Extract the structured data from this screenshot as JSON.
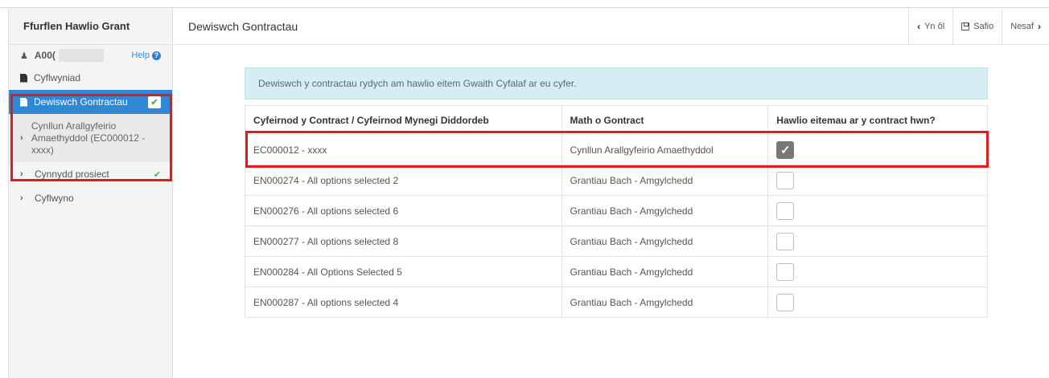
{
  "sidebar": {
    "title": "Ffurflen Hawlio Grant",
    "user_id": "A00(",
    "help_label": "Help",
    "items": [
      {
        "label": "Cyflwyniad"
      },
      {
        "label": "Dewiswch Gontractau",
        "checked": "✔"
      },
      {
        "label": "Cynllun Arallgyfeirio Amaethyddol (EC000012 - xxxx)",
        "chevron": "›"
      },
      {
        "label": "Cynnydd prosiect",
        "chevron": "›",
        "tick": "✔"
      },
      {
        "label": "Cyflwyno",
        "chevron": "›"
      }
    ]
  },
  "header": {
    "title": "Dewiswch Gontractau",
    "back_label": "Yn ôl",
    "save_label": "Safio",
    "next_label": "Nesaf"
  },
  "banner": "Dewiswch y contractau rydych am hawlio eitem Gwaith Cyfalaf ar eu cyfer.",
  "table": {
    "headers": [
      "Cyfeirnod y Contract / Cyfeirnod Mynegi Diddordeb",
      "Math o Gontract",
      "Hawlio eitemau ar y contract hwn?"
    ],
    "rows": [
      {
        "ref": "EC000012 - xxxx",
        "type": "Cynllun Arallgyfeirio Amaethyddol",
        "checked": true
      },
      {
        "ref": "EN000274 - All options selected 2",
        "type": "Grantiau Bach - Amgylchedd",
        "checked": false
      },
      {
        "ref": "EN000276 - All options selected 6",
        "type": "Grantiau Bach - Amgylchedd",
        "checked": false
      },
      {
        "ref": "EN000277 - All options selected 8",
        "type": "Grantiau Bach - Amgylchedd",
        "checked": false
      },
      {
        "ref": "EN000284 - All Options Selected 5",
        "type": "Grantiau Bach - Amgylchedd",
        "checked": false
      },
      {
        "ref": "EN000287 - All options selected 4",
        "type": "Grantiau Bach - Amgylchedd",
        "checked": false
      }
    ]
  },
  "icons": {
    "user": "user-icon",
    "help": "question-circle-icon",
    "document": "document-icon",
    "back": "chevron-left-icon",
    "save": "floppy-disk-icon",
    "next": "chevron-right-icon"
  },
  "colors": {
    "accent": "#2f88d6",
    "highlight": "#e11a1a",
    "banner_bg": "#d6eef3",
    "success": "#4caf50"
  }
}
